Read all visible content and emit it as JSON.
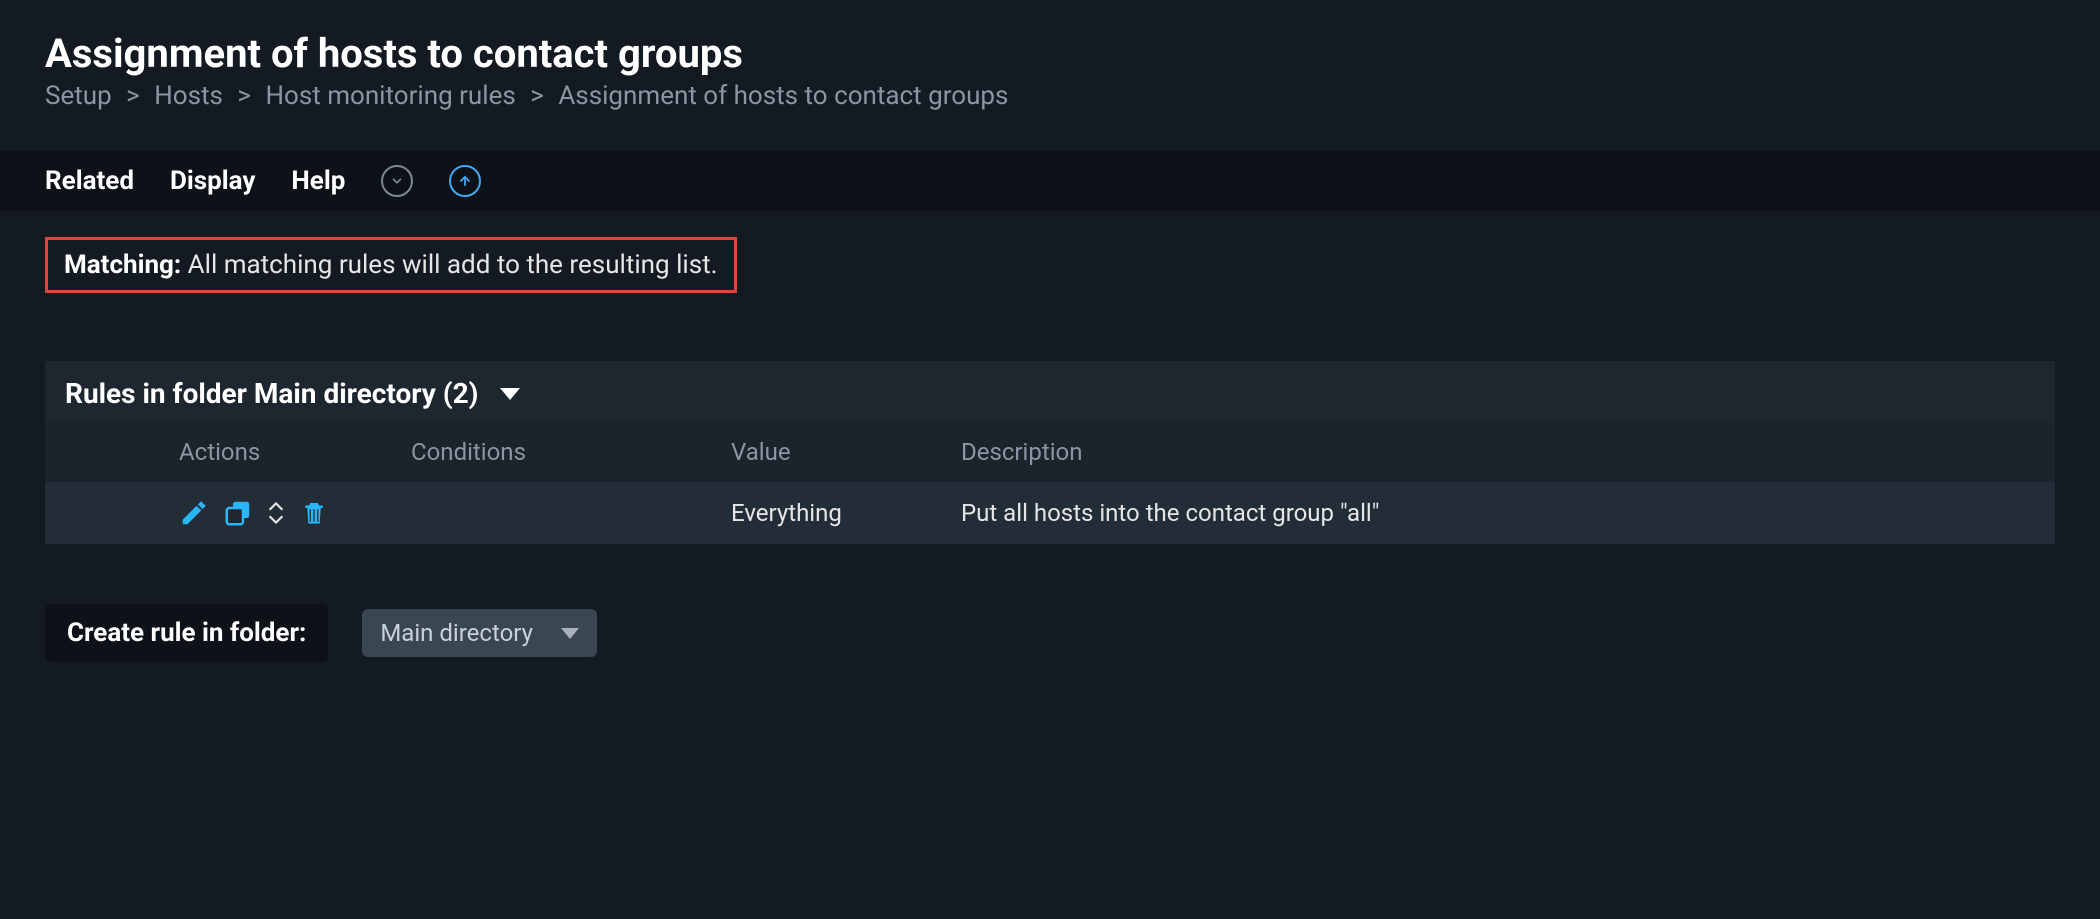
{
  "page_title": "Assignment of hosts to contact groups",
  "breadcrumb": [
    "Setup",
    "Hosts",
    "Host monitoring rules",
    "Assignment of hosts to contact groups"
  ],
  "menu": {
    "related": "Related",
    "display": "Display",
    "help": "Help"
  },
  "matching": {
    "label": "Matching:",
    "text": "All matching rules will add to the resulting list."
  },
  "rules_panel": {
    "heading": "Rules in folder Main directory (2)",
    "columns": {
      "actions": "Actions",
      "conditions": "Conditions",
      "value": "Value",
      "description": "Description"
    },
    "rows": [
      {
        "conditions": "",
        "value": "Everything",
        "description": "Put all hosts into the contact group \"all\""
      }
    ]
  },
  "create_rule": {
    "button": "Create rule in folder:",
    "selected_folder": "Main directory"
  },
  "colors": {
    "accent_red": "#d44b3a",
    "accent_blue": "#3fa9f5",
    "icon_blue": "#29b6f6"
  }
}
